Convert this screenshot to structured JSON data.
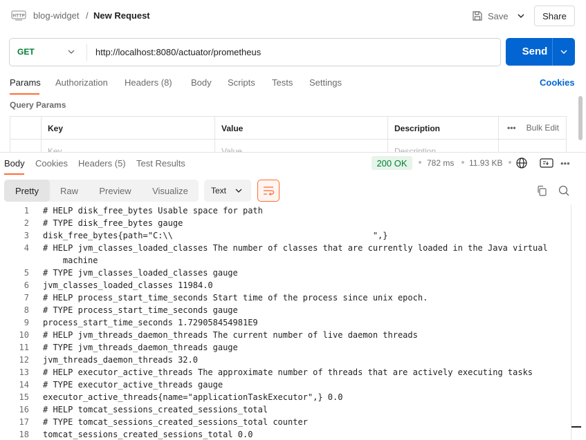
{
  "header": {
    "collection": "blog-widget",
    "separator": "/",
    "title": "New Request",
    "save_label": "Save",
    "share_label": "Share"
  },
  "request": {
    "method": "GET",
    "url": "http://localhost:8080/actuator/prometheus",
    "send_label": "Send",
    "tabs": [
      "Params",
      "Authorization",
      "Headers (8)",
      "Body",
      "Scripts",
      "Tests",
      "Settings"
    ],
    "cookies_label": "Cookies",
    "query_params_label": "Query Params",
    "table": {
      "headers": [
        "Key",
        "Value",
        "Description"
      ],
      "bulk_edit_label": "Bulk Edit",
      "placeholders": [
        "Key",
        "Value",
        "Description"
      ]
    }
  },
  "response": {
    "tabs": [
      "Body",
      "Cookies",
      "Headers (5)",
      "Test Results"
    ],
    "status": "200 OK",
    "time": "782 ms",
    "size": "11.93 KB",
    "view_modes": [
      "Pretty",
      "Raw",
      "Preview",
      "Visualize"
    ],
    "active_view": "Pretty",
    "format": "Text",
    "lines": [
      {
        "n": "1",
        "t": "# HELP disk_free_bytes Usable space for path"
      },
      {
        "n": "2",
        "t": "# TYPE disk_free_bytes gauge"
      },
      {
        "n": "3",
        "t": "disk_free_bytes{path=\"C:\\\\                                        \",} "
      },
      {
        "n": "4",
        "t": "# HELP jvm_classes_loaded_classes The number of classes that are currently loaded in the Java virtual"
      },
      {
        "n": "",
        "t": "    machine"
      },
      {
        "n": "5",
        "t": "# TYPE jvm_classes_loaded_classes gauge"
      },
      {
        "n": "6",
        "t": "jvm_classes_loaded_classes 11984.0"
      },
      {
        "n": "7",
        "t": "# HELP process_start_time_seconds Start time of the process since unix epoch."
      },
      {
        "n": "8",
        "t": "# TYPE process_start_time_seconds gauge"
      },
      {
        "n": "9",
        "t": "process_start_time_seconds 1.729058454981E9"
      },
      {
        "n": "10",
        "t": "# HELP jvm_threads_daemon_threads The current number of live daemon threads"
      },
      {
        "n": "11",
        "t": "# TYPE jvm_threads_daemon_threads gauge"
      },
      {
        "n": "12",
        "t": "jvm_threads_daemon_threads 32.0"
      },
      {
        "n": "13",
        "t": "# HELP executor_active_threads The approximate number of threads that are actively executing tasks"
      },
      {
        "n": "14",
        "t": "# TYPE executor_active_threads gauge"
      },
      {
        "n": "15",
        "t": "executor_active_threads{name=\"applicationTaskExecutor\",} 0.0"
      },
      {
        "n": "16",
        "t": "# HELP tomcat_sessions_created_sessions_total"
      },
      {
        "n": "17",
        "t": "# TYPE tomcat_sessions_created_sessions_total counter"
      },
      {
        "n": "18",
        "t": "tomcat_sessions_created_sessions_total 0.0"
      }
    ]
  },
  "colors": {
    "accent": "#ff6c37",
    "send": "#0265d2",
    "method_get": "#007f31",
    "status_ok": "#007f31"
  }
}
